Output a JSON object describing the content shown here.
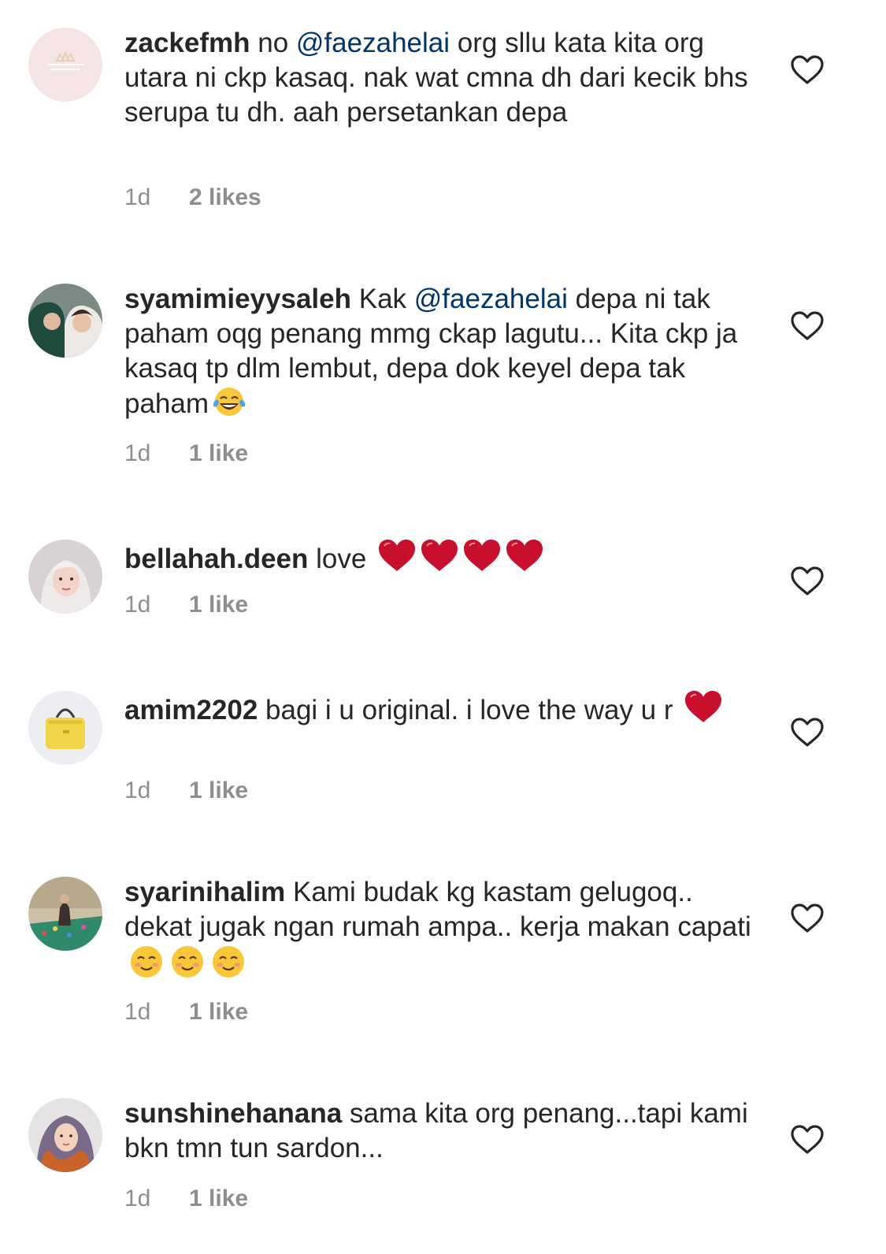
{
  "comments": [
    {
      "username": "zackefmh",
      "text_before": "no ",
      "mention": "@faezahelai",
      "text_after": "  org sllu kata kita org utara ni ckp kasaq. nak wat cmna dh dari kecik bhs serupa tu dh. aah persetankan depa",
      "time": "1d",
      "likes": "2 likes",
      "avatar_icon": "crown-logo-avatar"
    },
    {
      "username": "syamimieyysaleh",
      "text_before": "Kak ",
      "mention": "@faezahelai",
      "text_after": " depa ni tak paham oqg penang mmg ckap lagutu... Kita ckp ja kasaq tp dlm lembut, depa dok keyel depa tak paham",
      "emoji": "face-with-tears-of-joy",
      "time": "1d",
      "likes": "1 like",
      "avatar_icon": "two-women-photo-avatar"
    },
    {
      "username": "bellahah.deen",
      "text": "love ",
      "emoji": "red-heart x4",
      "time": "1d",
      "likes": "1 like",
      "avatar_icon": "woman-photo-avatar"
    },
    {
      "username": "amim2202",
      "text": "bagi i u original. i love the way u r ",
      "emoji": "red-heart",
      "time": "1d",
      "likes": "1 like",
      "avatar_icon": "yellow-bag-photo-avatar"
    },
    {
      "username": "syarinihalim",
      "text": "Kami budak kg kastam gelugoq.. dekat jugak ngan rumah ampa.. kerja makan capati ",
      "emoji": "smiling-face x3",
      "time": "1d",
      "likes": "1 like",
      "avatar_icon": "pool-photo-avatar"
    },
    {
      "username": "sunshinehanana",
      "text": "sama kita org penang...tapi kami bkn tmn tun sardon...",
      "time": "1d",
      "likes": "1 like",
      "avatar_icon": "hijab-woman-photo-avatar"
    }
  ],
  "colors": {
    "text": "#262626",
    "mention": "#003569",
    "meta": "#8e8e8e",
    "heart_emoji": "#c8102e",
    "like_icon": "#262626"
  }
}
